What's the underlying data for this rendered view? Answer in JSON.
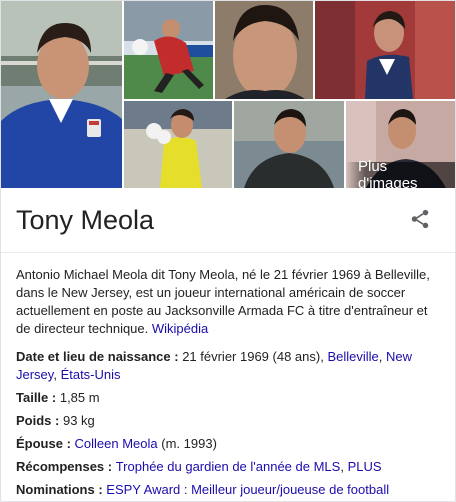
{
  "title": "Tony Meola",
  "more_images": "Plus d'images",
  "description": {
    "text": "Antonio Michael Meola dit Tony Meola, né le 21 février 1969 à Belleville, dans le New Jersey, est un joueur international américain de soccer actuellement en poste au Jacksonville Armada FC à titre d'entraîneur et de directeur technique.",
    "source_link": "Wikipédia"
  },
  "facts": {
    "birth": {
      "label": "Date et lieu de naissance",
      "value": "21 février 1969 (48 ans),",
      "link1": "Belleville",
      "link2": "New Jersey",
      "link3": "États-Unis"
    },
    "height": {
      "label": "Taille",
      "value": "1,85 m"
    },
    "weight": {
      "label": "Poids",
      "value": "93 kg"
    },
    "spouse": {
      "label": "Épouse",
      "link": "Colleen Meola",
      "value": "(m. 1993)"
    },
    "awards": {
      "label": "Récompenses",
      "link1": "Trophée du gardien de l'année de MLS",
      "link2": "PLUS"
    },
    "nominations": {
      "label": "Nominations",
      "link": "ESPY Award : Meilleur joueur/joueuse de football"
    }
  },
  "colors": {
    "link": "#1a0dab",
    "text": "#222222",
    "usa_blue": "#1f3c8c"
  },
  "icons": {
    "share": "share-icon"
  }
}
